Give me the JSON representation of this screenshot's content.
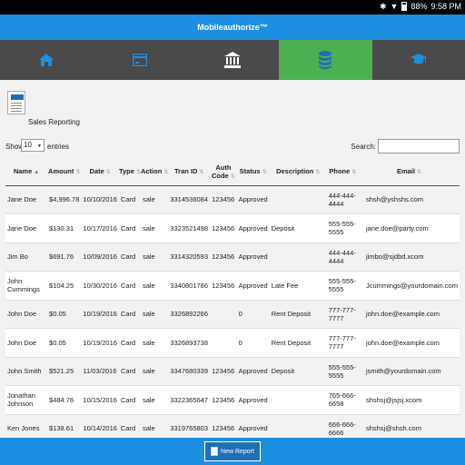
{
  "status_bar": {
    "battery": "88%",
    "time": "9:58 PM"
  },
  "app": {
    "title": "Mobileauthorize™"
  },
  "nav": [
    {
      "icon": "home-icon"
    },
    {
      "icon": "credit-card-icon"
    },
    {
      "icon": "bank-icon"
    },
    {
      "icon": "database-icon",
      "active": true
    },
    {
      "icon": "graduation-cap-icon"
    }
  ],
  "report": {
    "title": "Sales Reporting"
  },
  "controls": {
    "show_label": "Show",
    "page_size": "10",
    "entries_label": "entries",
    "search_label": "Search:",
    "search_value": ""
  },
  "table": {
    "columns": [
      "Name",
      "Amount",
      "Date",
      "Type",
      "Action",
      "Tran ID",
      "Auth Code",
      "Status",
      "Description",
      "Phone",
      "Email"
    ],
    "rows": [
      [
        "Jane Doe",
        "$4,996.78",
        "10/10/2016",
        "Card",
        "sale",
        "3314536084",
        "123456",
        "Approved",
        "",
        "444-444-4444",
        "shsh@yshshs.com"
      ],
      [
        "Jane Doe",
        "$130.31",
        "10/17/2016",
        "Card",
        "sale",
        "3323521498",
        "123456",
        "Approved",
        "Deposit",
        "555-555-5555",
        "jane.doe@party.com"
      ],
      [
        "Jim Bo",
        "$691.76",
        "10/09/2016",
        "Card",
        "sale",
        "3314320593",
        "123456",
        "Approved",
        "",
        "444-444-4444",
        "jimbo@sjdbd.xcom"
      ],
      [
        "John Cummings",
        "$104.25",
        "10/30/2016",
        "Card",
        "sale",
        "3340801786",
        "123456",
        "Approved",
        "Late Fee",
        "555-555-5555",
        "Jcummings@yourdomain.com"
      ],
      [
        "John Doe",
        "$0.05",
        "10/19/2016",
        "Card",
        "sale",
        "3326892266",
        "",
        "0",
        "Rent Deposit",
        "777-777-7777",
        "john.doe@example.com"
      ],
      [
        "John Doe",
        "$0.05",
        "10/19/2016",
        "Card",
        "sale",
        "3326893738",
        "",
        "0",
        "Rent Deposit",
        "777-777-7777",
        "john.doe@example.com"
      ],
      [
        "John Smith",
        "$521.25",
        "11/03/2016",
        "Card",
        "sale",
        "3347680339",
        "123456",
        "Approved",
        "Deposit",
        "555-555-5555",
        "jsmith@yourdomain.com"
      ],
      [
        "Jonathan Johnson",
        "$484.76",
        "10/15/2016",
        "Card",
        "sale",
        "3322365647",
        "123456",
        "Approved",
        "",
        "765-666-6658",
        "shshsj@jsjsj.xcom"
      ],
      [
        "Ken Jones",
        "$138.61",
        "10/14/2016",
        "Card",
        "sale",
        "3319765803",
        "123456",
        "Approved",
        "",
        "666-666-6666",
        "shshsj@shsh.com"
      ]
    ]
  },
  "bottom": {
    "new_report_label": "New Report"
  }
}
